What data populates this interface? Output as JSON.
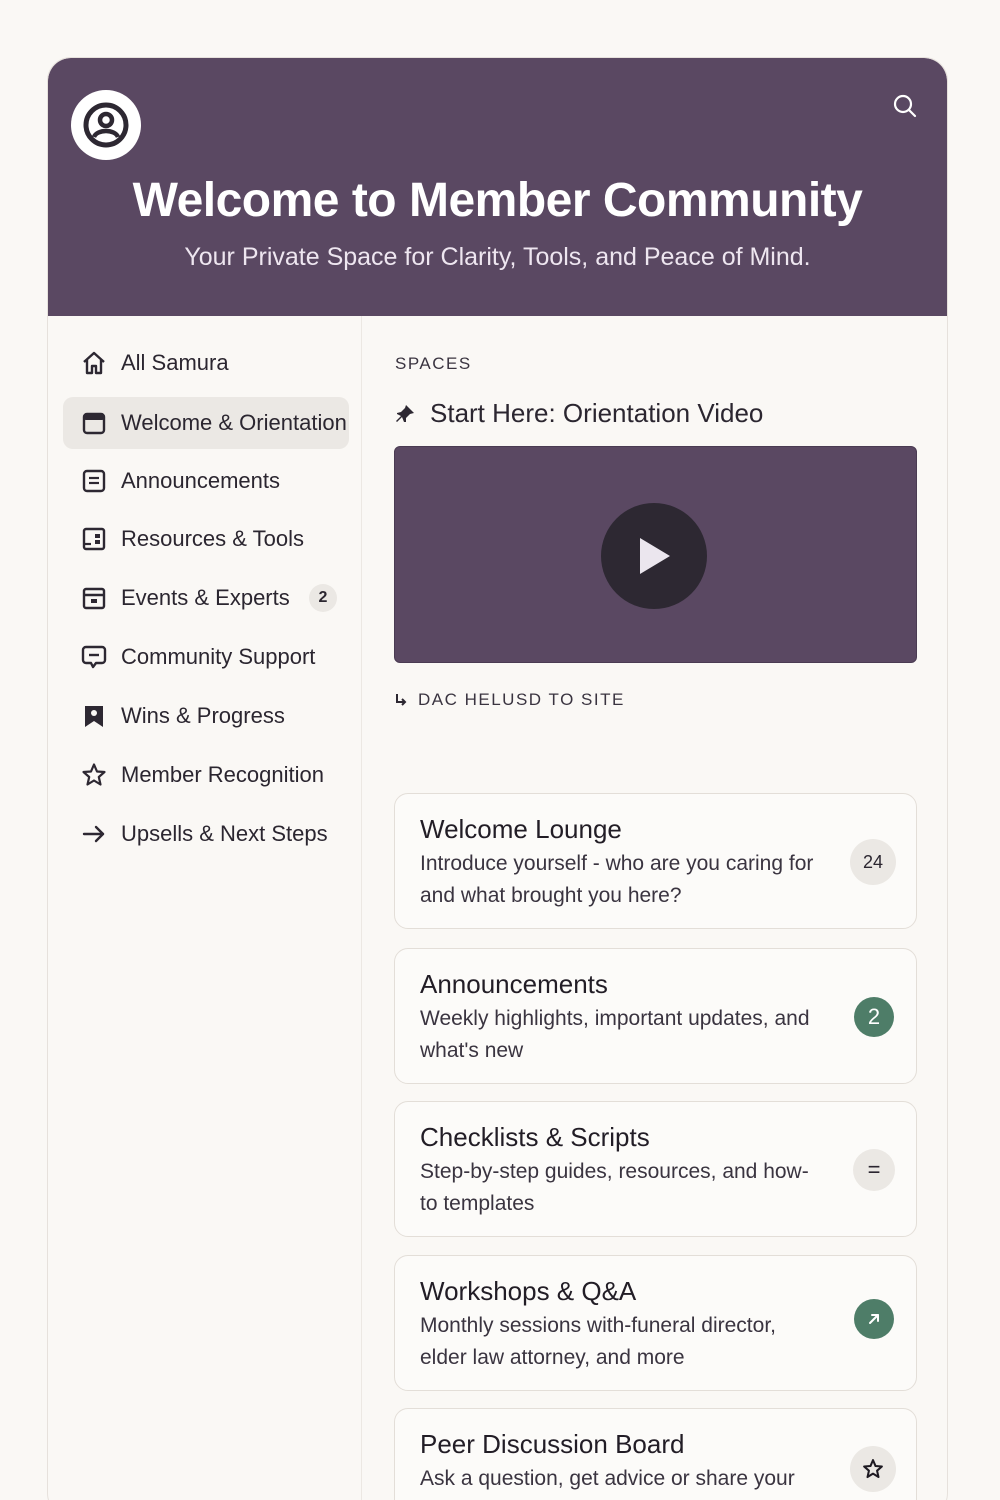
{
  "header": {
    "title": "Welcome to Member Community",
    "subtitle": "Your Private Space for Clarity, Tools, and Peace of Mind.",
    "logo_icon": "user-circle-icon",
    "search_icon": "search-icon"
  },
  "colors": {
    "brand": "#5a4862",
    "accent_green": "#4e7d68",
    "background": "#faf8f5"
  },
  "sidebar": {
    "items": [
      {
        "label": "All Samura",
        "icon": "home-icon"
      },
      {
        "label": "Welcome & Orientation",
        "icon": "folder-icon",
        "active": true
      },
      {
        "label": "Announcements",
        "icon": "document-icon"
      },
      {
        "label": "Resources & Tools",
        "icon": "book-icon"
      },
      {
        "label": "Events & Experts",
        "icon": "calendar-icon",
        "badge": "2"
      },
      {
        "label": "Community Support",
        "icon": "chat-icon"
      },
      {
        "label": "Wins & Progress",
        "icon": "bookmark-icon"
      },
      {
        "label": "Member Recognition",
        "icon": "star-icon"
      },
      {
        "label": "Upsells & Next Steps",
        "icon": "arrow-right-icon"
      }
    ]
  },
  "main": {
    "section_label": "SPACES",
    "start_here": "Start Here: Orientation Video",
    "sub_label": "DAC HELUSD TO SITE",
    "cards": [
      {
        "title": "Welcome Lounge",
        "desc": "Introduce yourself - who are you caring for and what brought you here?",
        "badge": "24"
      },
      {
        "title": "Announcements",
        "desc": "Weekly highlights, important updates, and what's new",
        "badge": "2"
      },
      {
        "title": "Checklists & Scripts",
        "desc": "Step-by-step guides, resources, and how-to templates",
        "badge": "="
      },
      {
        "title": "Workshops & Q&A",
        "desc": "Monthly sessions with-funeral director, elder law attorney, and more",
        "badge_icon": "arrow-up-right-icon"
      },
      {
        "title": "Peer Discussion Board",
        "desc": "Ask a question, get advice or share your story",
        "badge_icon": "star-icon"
      }
    ]
  }
}
